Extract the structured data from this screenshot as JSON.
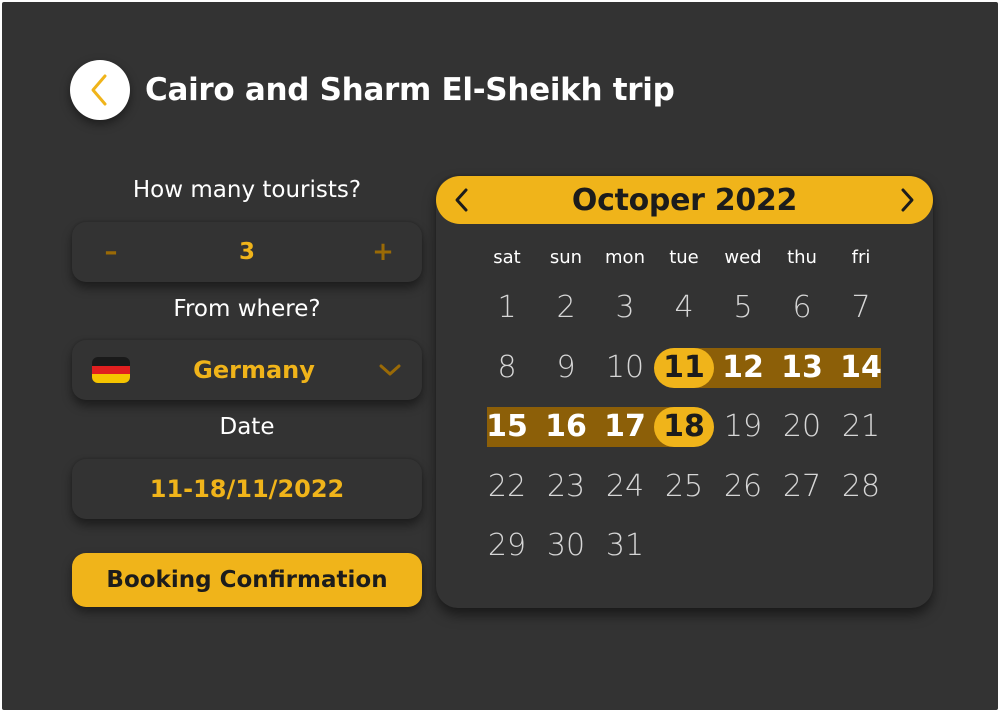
{
  "header": {
    "title": "Cairo and Sharm El-Sheikh trip",
    "back_icon": "chevron-left-icon"
  },
  "tourists": {
    "label": "How many tourists?",
    "minus_label": "–",
    "value": "3",
    "plus_label": "+"
  },
  "origin": {
    "label": "From where?",
    "flag_icon": "germany-flag-icon",
    "value": "Germany",
    "dropdown_icon": "chevron-down-icon"
  },
  "date": {
    "label": "Date",
    "value": "11-18/11/2022"
  },
  "confirm": {
    "label": "Booking Confirmation"
  },
  "calendar": {
    "month_label": "Octoper 2022",
    "weekdays": [
      "sat",
      "sun",
      "mon",
      "tue",
      "wed",
      "thu",
      "fri"
    ],
    "first_weekday_index": 0,
    "days_in_month": 31,
    "range_start": 11,
    "range_end": 18
  },
  "colors": {
    "background": "#333333",
    "accent": "#f0b41a",
    "range_fill": "#8c5f08",
    "muted_accent": "#9a6a06",
    "text_primary": "#ffffff",
    "text_dark": "#1c1c1c"
  }
}
